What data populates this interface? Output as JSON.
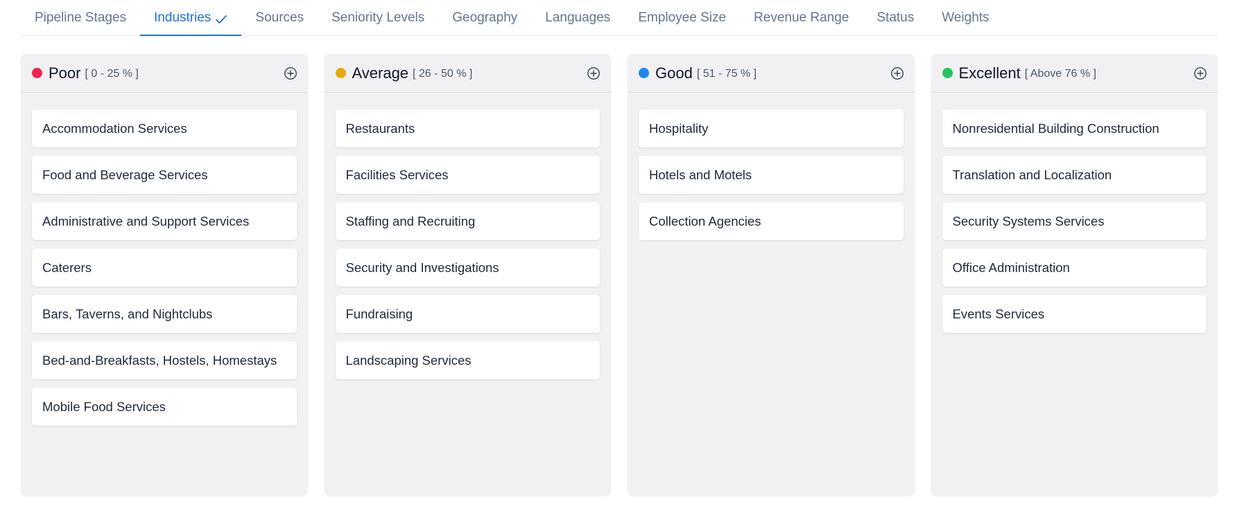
{
  "tabs": [
    {
      "label": "Pipeline Stages",
      "active": false
    },
    {
      "label": "Industries",
      "active": true
    },
    {
      "label": "Sources",
      "active": false
    },
    {
      "label": "Seniority Levels",
      "active": false
    },
    {
      "label": "Geography",
      "active": false
    },
    {
      "label": "Languages",
      "active": false
    },
    {
      "label": "Employee Size",
      "active": false
    },
    {
      "label": "Revenue Range",
      "active": false
    },
    {
      "label": "Status",
      "active": false
    },
    {
      "label": "Weights",
      "active": false
    }
  ],
  "active_tab_icon": "check-icon",
  "accent_color": "#1e6fd6",
  "columns": [
    {
      "title": "Poor",
      "range": "[ 0 - 25 % ]",
      "dot_color": "#f0254f",
      "add_icon": "plus-circle-icon",
      "items": [
        "Accommodation Services",
        "Food and Beverage Services",
        "Administrative and Support Services",
        "Caterers",
        "Bars, Taverns, and Nightclubs",
        "Bed-and-Breakfasts, Hostels, Homestays",
        "Mobile Food Services"
      ]
    },
    {
      "title": "Average",
      "range": "[ 26 - 50 % ]",
      "dot_color": "#e8a910",
      "add_icon": "plus-circle-icon",
      "items": [
        "Restaurants",
        "Facilities Services",
        "Staffing and Recruiting",
        "Security and Investigations",
        "Fundraising",
        "Landscaping Services"
      ]
    },
    {
      "title": "Good",
      "range": "[ 51 - 75 % ]",
      "dot_color": "#1f86f0",
      "add_icon": "plus-circle-icon",
      "items": [
        "Hospitality",
        "Hotels and Motels",
        "Collection Agencies"
      ]
    },
    {
      "title": "Excellent",
      "range": "[ Above 76 % ]",
      "dot_color": "#22c55e",
      "add_icon": "plus-circle-icon",
      "items": [
        "Nonresidential Building Construction",
        "Translation and Localization",
        "Security Systems Services",
        "Office Administration",
        "Events Services"
      ]
    }
  ]
}
